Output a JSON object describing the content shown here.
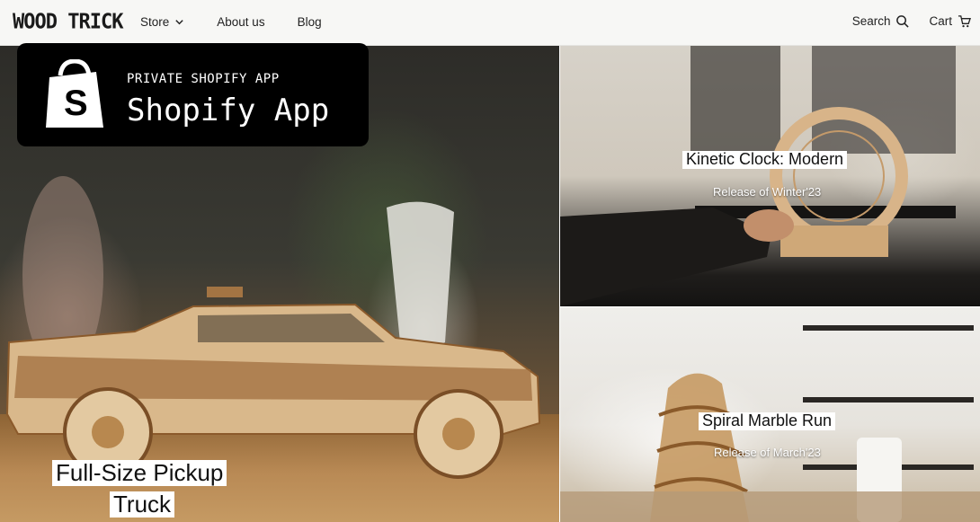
{
  "header": {
    "logo": "WOOD TRICK",
    "nav": {
      "store": "Store",
      "about": "About us",
      "blog": "Blog"
    },
    "search": "Search",
    "cart": "Cart"
  },
  "badge": {
    "kicker": "PRIVATE SHOPIFY APP",
    "title": "Shopify App"
  },
  "products": {
    "pickup": {
      "line1": "Full-Size Pickup",
      "line2": "Truck"
    },
    "clock": {
      "title": "Kinetic Clock: Modern",
      "release": "Release of Winter'23"
    },
    "marble": {
      "title": "Spiral Marble Run",
      "release": "Release of March'23"
    }
  },
  "icons": [
    "chevron-down-icon",
    "search-icon",
    "cart-icon",
    "shopify-bag-icon"
  ],
  "colors": {
    "header_bg": "#f7f7f5",
    "badge_bg": "#000000",
    "label_bg": "#ffffff",
    "wood": "#c59a63"
  }
}
